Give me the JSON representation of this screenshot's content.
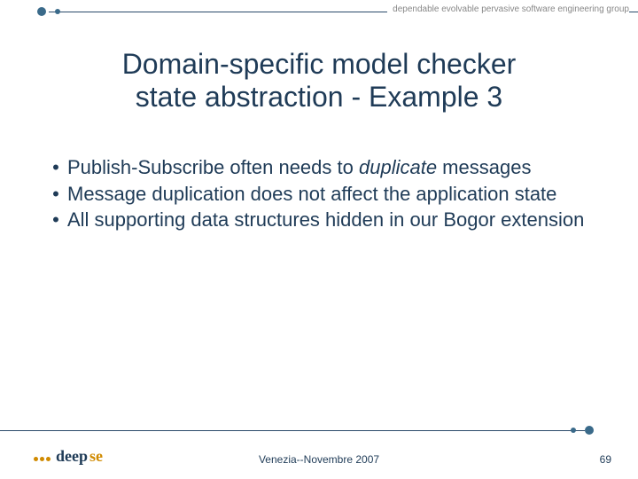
{
  "header": {
    "org_text": "dependable evolvable pervasive software engineering group"
  },
  "title": {
    "line1": "Domain-specific model checker",
    "line2": "state abstraction - Example 3"
  },
  "bullets": [
    {
      "pre": "Publish-Subscribe often needs to ",
      "em": "duplicate",
      "post": " messages"
    },
    {
      "pre": "Message duplication does not affect the application state",
      "em": "",
      "post": ""
    },
    {
      "pre": "All supporting data structures hidden in our Bogor extension",
      "em": "",
      "post": ""
    }
  ],
  "footer": {
    "venue": "Venezia--Novembre 2007",
    "page": "69",
    "logo_deep": "deep",
    "logo_se": "se"
  }
}
